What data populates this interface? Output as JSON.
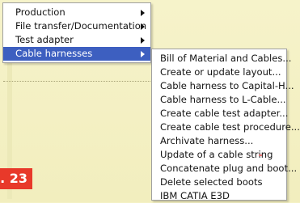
{
  "main_menu": {
    "items": [
      {
        "label": "Production",
        "has_submenu": true,
        "selected": false
      },
      {
        "label": "File transfer/Documentation",
        "has_submenu": true,
        "selected": false
      },
      {
        "label": "Test adapter",
        "has_submenu": true,
        "selected": false
      },
      {
        "label": "Cable harnesses",
        "has_submenu": true,
        "selected": true
      }
    ]
  },
  "sub_menu": {
    "items": [
      {
        "label": "Bill of Material and Cables..."
      },
      {
        "label": "Create or update layout..."
      },
      {
        "label": "Cable harness to Capital-H..."
      },
      {
        "label": "Cable harness to L-Cable..."
      },
      {
        "label": "Create cable test adapter..."
      },
      {
        "label": "Create cable test procedure..."
      },
      {
        "label": "Archivate harness..."
      },
      {
        "label": "Update of a cable string"
      },
      {
        "label": "Concatenate plug and boot..."
      },
      {
        "label": "Delete selected boots"
      },
      {
        "label": "IBM CATIA E3D"
      }
    ]
  },
  "figure_badge": {
    "label": ". 23"
  },
  "colors": {
    "selection": "#3d5fc0",
    "badge": "#e8392a",
    "background": "#f4f1c4"
  }
}
